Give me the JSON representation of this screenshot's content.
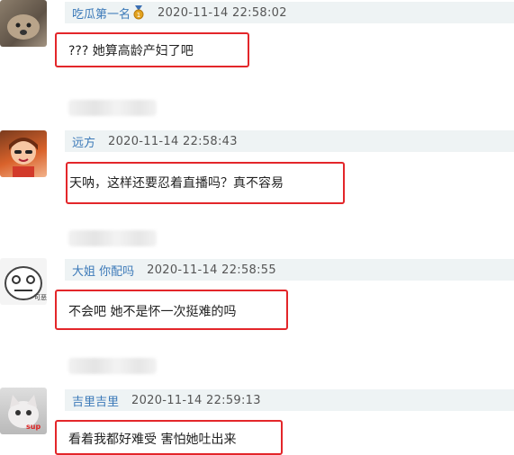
{
  "comments": [
    {
      "user": "吃瓜第一名",
      "badge": "medal-icon",
      "time": "2020-11-14 22:58:02",
      "text": "??? 她算高龄产妇了吧"
    },
    {
      "user": "远方",
      "time": "2020-11-14 22:58:43",
      "text": "天呐，这样还要忍着直播吗？真不容易"
    },
    {
      "user": "大姐 你配吗",
      "time": "2020-11-14 22:58:55",
      "text": "不会吧 她不是怀一次挺难的吗"
    },
    {
      "user": "吉里吉里",
      "time": "2020-11-14 22:59:13",
      "text": "看着我都好难受 害怕她吐出来"
    }
  ],
  "colors": {
    "highlight": "#e3262a",
    "username": "#3b79b8",
    "meta_bg": "#eef3f4"
  }
}
